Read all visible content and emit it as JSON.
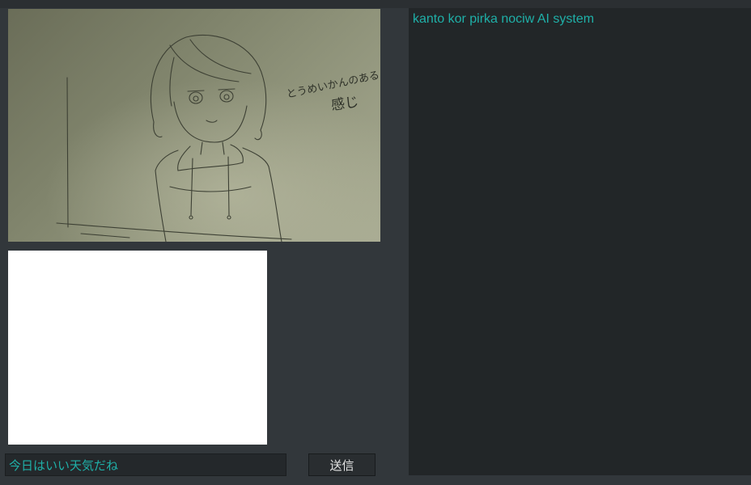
{
  "input": {
    "value": "今日はいい天気だね"
  },
  "send_button": {
    "label": "送信"
  },
  "chat_log": {
    "title": "kanto kor pirka nociw AI system"
  },
  "sketch": {
    "annotation_line1": "とうめいかんのある",
    "annotation_line2": "感じ"
  },
  "colors": {
    "accent": "#1fb0a8",
    "background": "#32373b",
    "panel": "#222628"
  }
}
